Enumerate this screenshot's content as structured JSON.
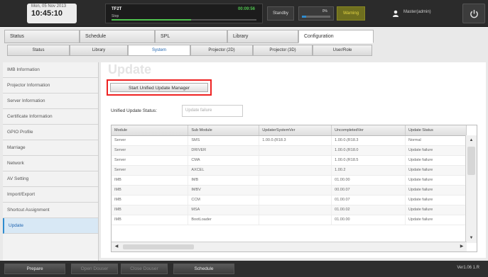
{
  "clock": {
    "date": "Mon, 05 Nov 2013",
    "time": "10:45:10"
  },
  "status_panel": {
    "screen": "TF2T",
    "sub": "Stop",
    "timer": "00:09:56",
    "progress_fraction": 0.55
  },
  "standby_label": "Standby",
  "meter": {
    "label": "0%",
    "fill_fraction": 0.15
  },
  "warning_label": "Warning",
  "user": {
    "name": "Master(admin)",
    "icon": "user-icon"
  },
  "power_icon": "power-icon",
  "main_tabs": [
    {
      "label": "Status"
    },
    {
      "label": "Schedule"
    },
    {
      "label": "SPL"
    },
    {
      "label": "Library"
    },
    {
      "label": "Configuration"
    }
  ],
  "sub_tabs": [
    {
      "label": "Status"
    },
    {
      "label": "Library"
    },
    {
      "label": "System"
    },
    {
      "label": "Projector (2D)"
    },
    {
      "label": "Projector (3D)"
    },
    {
      "label": "User/Role"
    }
  ],
  "sidebar": [
    {
      "label": "IMB Information"
    },
    {
      "label": "Projector Information"
    },
    {
      "label": "Server Information"
    },
    {
      "label": "Certificate Information"
    },
    {
      "label": "GPIO Profile"
    },
    {
      "label": "Marriage"
    },
    {
      "label": "Network"
    },
    {
      "label": "AV Setting"
    },
    {
      "label": "Import/Export"
    },
    {
      "label": "Shortcut Assignment"
    },
    {
      "label": "Update"
    }
  ],
  "page_title": "Update",
  "start_button_label": "Start Unified Update Manager",
  "unified_update": {
    "label": "Unified Update Status:",
    "value": "Update failure"
  },
  "table": {
    "headers": [
      "Module",
      "Sub Module",
      "UpdaterSystemVer",
      "UncompletedVer",
      "Update Status"
    ],
    "rows": [
      [
        "Server",
        "SMS",
        "1.00.0.(R18.3",
        "1.00.0.(R18.3",
        "Normal"
      ],
      [
        "Server",
        "DRIVER",
        "",
        "1.00.0.(R18.0",
        "Update failure"
      ],
      [
        "Server",
        "CMA",
        "",
        "1.00.0.(R18.5",
        "Update failure"
      ],
      [
        "Server",
        "AXCEL",
        "",
        "1.00.2",
        "Update failure"
      ],
      [
        "IMB",
        "IMB",
        "",
        "01.00.00",
        "Update failure"
      ],
      [
        "IMB",
        "IMBV",
        "",
        "00.00.07",
        "Update failure"
      ],
      [
        "IMB",
        "CCM",
        "",
        "01.00.07",
        "Update failure"
      ],
      [
        "IMB",
        "MSA",
        "",
        "01.00.02",
        "Update failure"
      ],
      [
        "IMB",
        "BootLoader",
        "",
        "01.00.00",
        "Update failure"
      ]
    ]
  },
  "footer": {
    "buttons": [
      {
        "label": "Prepare"
      },
      {
        "label": "Open Douser"
      },
      {
        "label": "Close Douser"
      },
      {
        "label": "Schedule"
      }
    ],
    "version": "Ver1.06 1.R"
  },
  "colors": {
    "accent": "#2f8ccf",
    "highlight_border": "#e22222",
    "warning": "#e4d544",
    "active_timer": "#4fc34f"
  }
}
